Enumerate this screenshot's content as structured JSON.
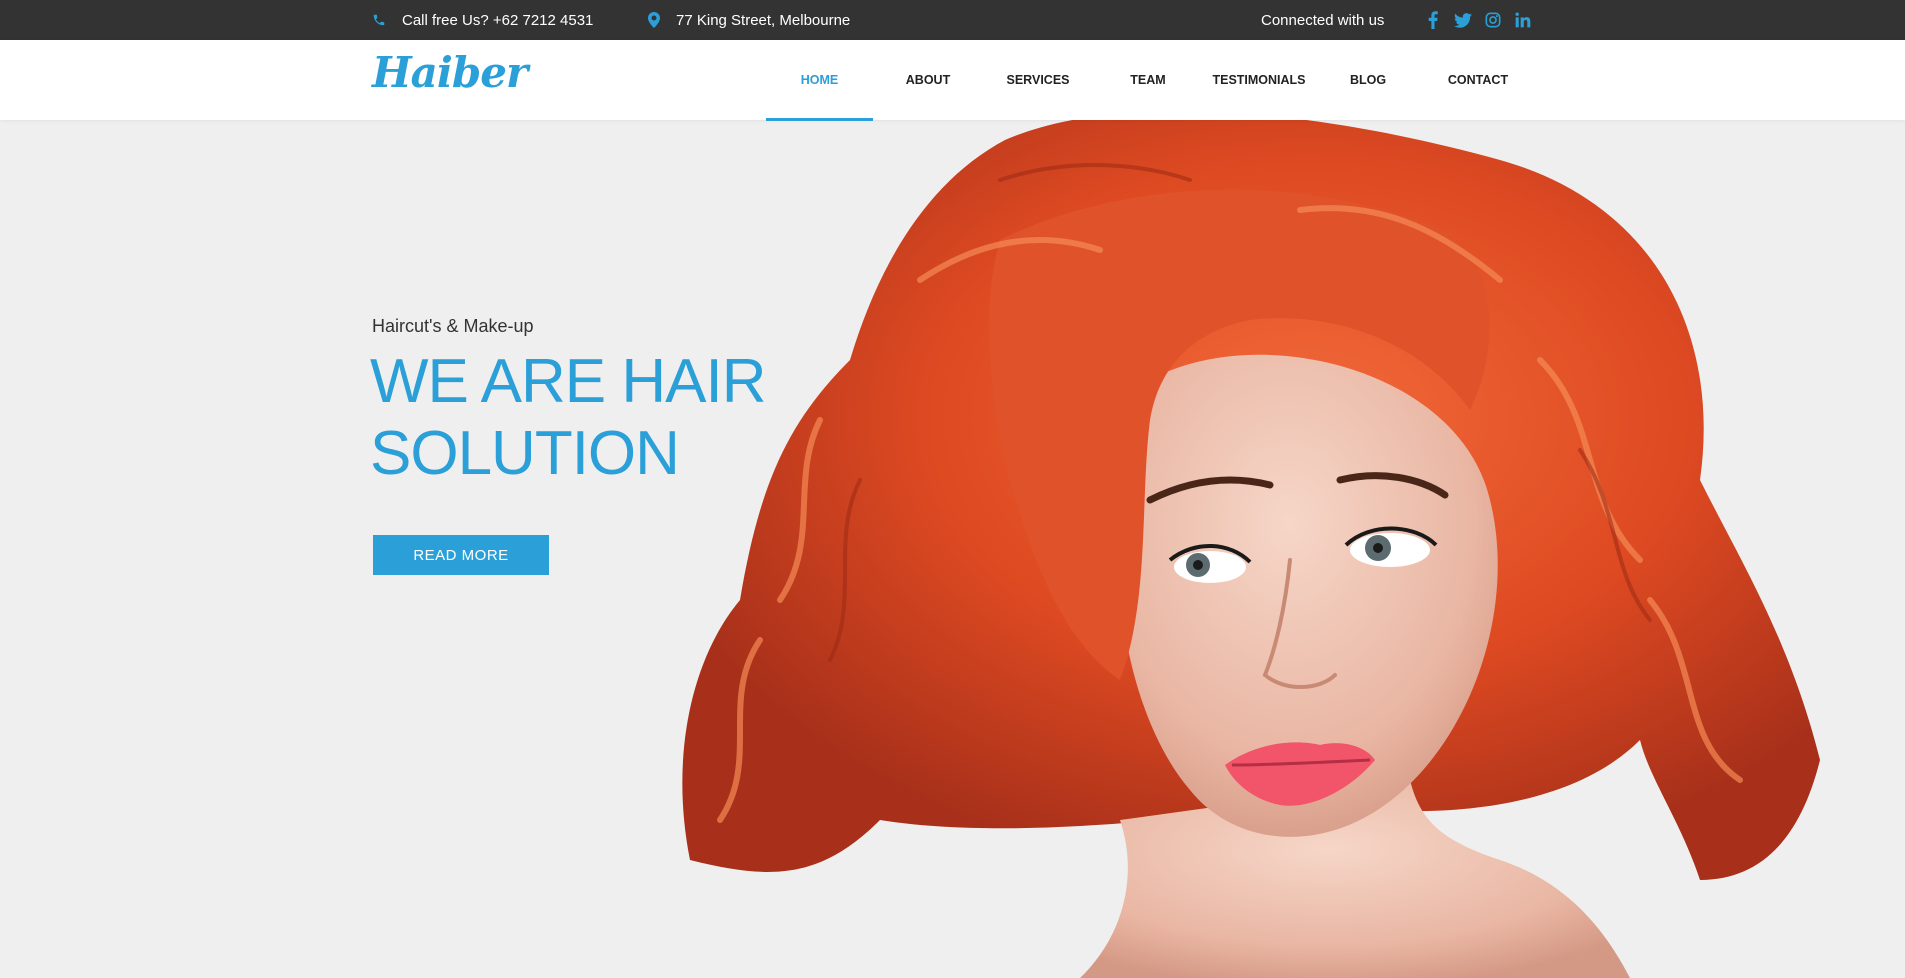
{
  "topbar": {
    "phone_text": "Call free Us? +62 7212 4531",
    "address_text": "77 King Street, Melbourne",
    "connected_text": "Connected with us",
    "socials": [
      {
        "icon": "facebook-icon",
        "label": "f"
      },
      {
        "icon": "twitter-icon",
        "label": "twitter"
      },
      {
        "icon": "instagram-icon",
        "label": "instagram"
      },
      {
        "icon": "linkedin-icon",
        "label": "in"
      }
    ]
  },
  "header": {
    "logo": "Haiber",
    "nav": [
      {
        "label": "HOME",
        "active": true
      },
      {
        "label": "ABOUT",
        "active": false
      },
      {
        "label": "SERVICES",
        "active": false
      },
      {
        "label": "TEAM",
        "active": false
      },
      {
        "label": "TESTIMONIALS",
        "active": false
      },
      {
        "label": "BLOG",
        "active": false
      },
      {
        "label": "CONTACT",
        "active": false
      }
    ]
  },
  "hero": {
    "subtitle": "Haircut's & Make-up",
    "title_line1": "WE ARE HAIR",
    "title_line2": "SOLUTION",
    "button_label": "READ MORE",
    "image_alt": "woman-with-red-curly-hair"
  },
  "colors": {
    "accent": "#2a9fd8",
    "topbar_bg": "#333333",
    "hero_bg": "#efefef",
    "hair": "#e0532a"
  }
}
